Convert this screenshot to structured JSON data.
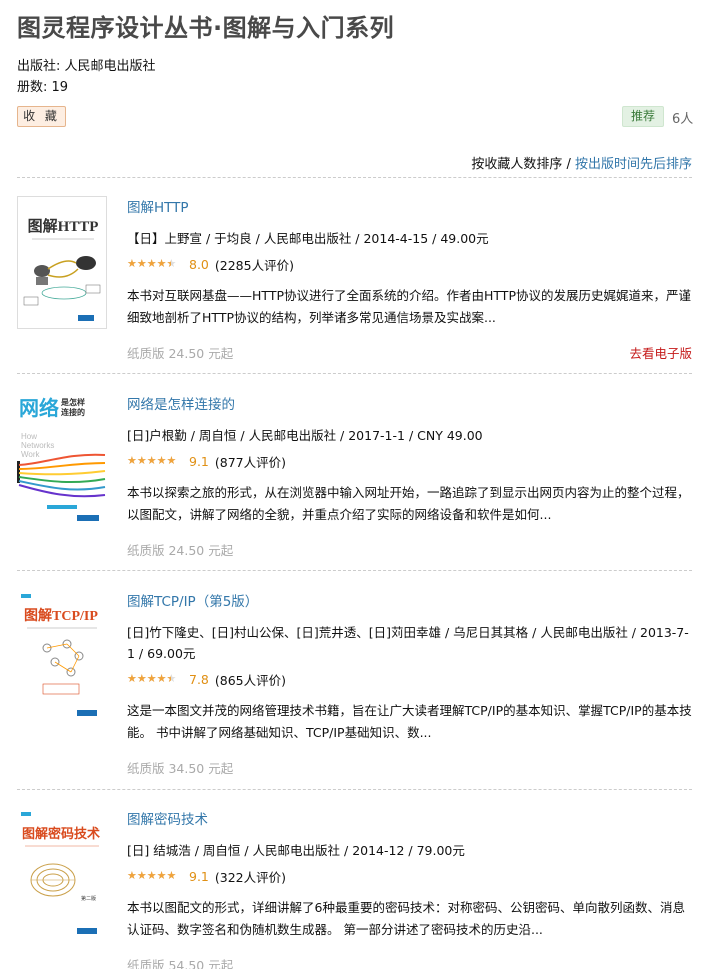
{
  "header": {
    "title": "图灵程序设计丛书·图解与入门系列",
    "publisher": "出版社: 人民邮电出版社",
    "count": "册数: 19"
  },
  "actions": {
    "collect_label": "收 藏",
    "recommend_label": "推荐",
    "recommend_count": "6人"
  },
  "sort": {
    "by_collect": "按收藏人数排序",
    "separator": " / ",
    "by_date": "按出版时间先后排序"
  },
  "books": [
    {
      "title": "图解HTTP",
      "pub": "【日】上野宣 / 于均良 / 人民邮电出版社 / 2014-4-15 / 49.00元",
      "stars": 4.0,
      "score": "8.0",
      "votes": "(2285人评价)",
      "desc": "本书对互联网基盘——HTTP协议进行了全面系统的介绍。作者由HTTP协议的发展历史娓娓道来，严谨细致地剖析了HTTP协议的结构，列举诸多常见通信场景及实战案...",
      "paper": "纸质版 24.50 元起",
      "ebook": "去看电子版",
      "cover_title": "图解HTTP"
    },
    {
      "title": "网络是怎样连接的",
      "pub": "[日]户根勤 / 周自恒 / 人民邮电出版社 / 2017-1-1 / CNY 49.00",
      "stars": 4.5,
      "score": "9.1",
      "votes": "(877人评价)",
      "desc": "本书以探索之旅的形式，从在浏览器中输入网址开始，一路追踪了到显示出网页内容为止的整个过程，以图配文，讲解了网络的全貌，并重点介绍了实际的网络设备和软件是如何...",
      "paper": "纸质版 24.50 元起",
      "ebook": "",
      "cover_title": "网络是怎样连接的"
    },
    {
      "title": "图解TCP/IP（第5版）",
      "pub": "[日]竹下隆史、[日]村山公保、[日]荒井透、[日]苅田幸雄 / 乌尼日其其格 / 人民邮电出版社 / 2013-7-1 / 69.00元",
      "stars": 4.0,
      "score": "7.8",
      "votes": "(865人评价)",
      "desc": "这是一本图文并茂的网络管理技术书籍，旨在让广大读者理解TCP/IP的基本知识、掌握TCP/IP的基本技能。 书中讲解了网络基础知识、TCP/IP基础知识、数...",
      "paper": "纸质版 34.50 元起",
      "ebook": "",
      "cover_title": "图解TCP/IP"
    },
    {
      "title": "图解密码技术",
      "pub": "[日] 结城浩 / 周自恒 / 人民邮电出版社 / 2014-12 / 79.00元",
      "stars": 4.5,
      "score": "9.1",
      "votes": "(322人评价)",
      "desc": "本书以图配文的形式，详细讲解了6种最重要的密码技术：对称密码、公钥密码、单向散列函数、消息认证码、数字签名和伪随机数生成器。 第一部分讲述了密码技术的历史沿...",
      "paper": "纸质版 54.50 元起",
      "ebook": "",
      "cover_title": "图解密码技术"
    }
  ],
  "colors": {
    "link": "#3377aa",
    "star": "#f0a33b",
    "score": "#e09015",
    "ebook": "#c51a1a",
    "collect_bg": "#fdeee2",
    "recommend_bg": "#e3f1e3"
  }
}
